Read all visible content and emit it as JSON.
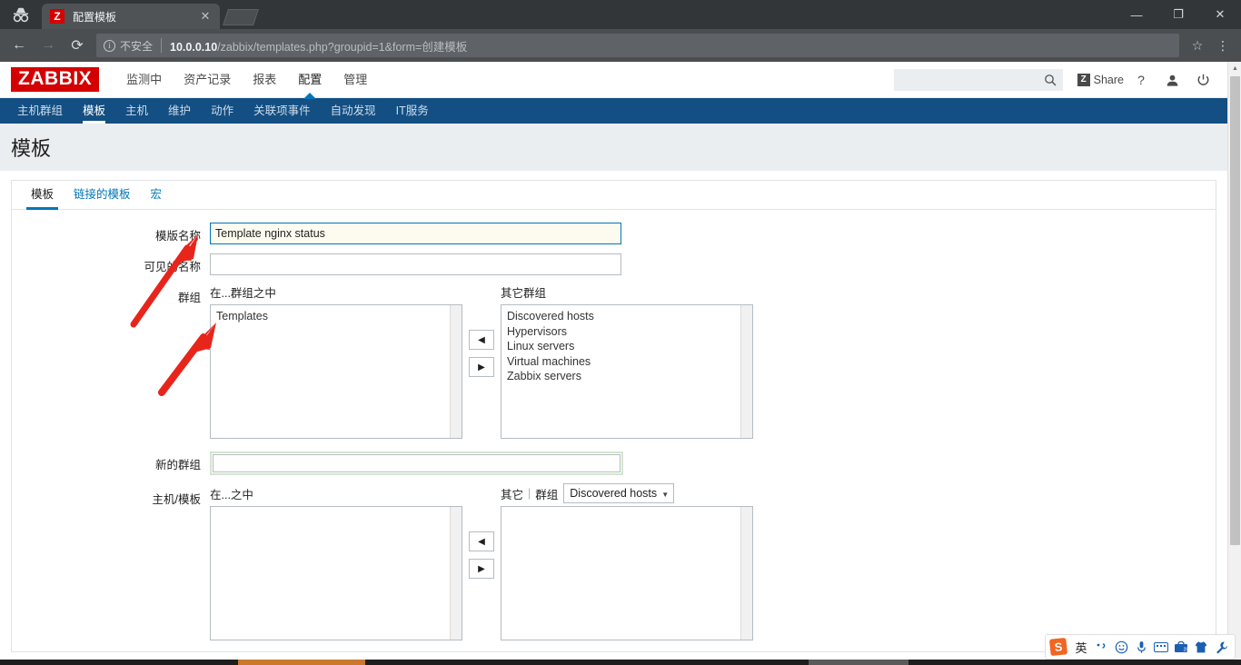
{
  "browser": {
    "tab": {
      "title": "配置模板",
      "favicon_letter": "Z",
      "close_label": "✕"
    },
    "incognito_icon": "incognito-icon",
    "new_tab_label": "",
    "window_controls": {
      "minimize": "—",
      "maximize": "❐",
      "close": "✕"
    },
    "nav": {
      "back": "←",
      "forward": "→",
      "reload": "⟳"
    },
    "omnibox": {
      "security_label": "不安全",
      "info_glyph": "i",
      "url_host": "10.0.0.10",
      "url_path": "/zabbix/templates.php?groupid=1&form=创建模板"
    },
    "toolbar_icons": {
      "bookmark": "☆",
      "menu": "⋮"
    }
  },
  "zabbix": {
    "logo": "ZABBIX",
    "main_nav": [
      {
        "label": "监测中",
        "active": false
      },
      {
        "label": "资产记录",
        "active": false
      },
      {
        "label": "报表",
        "active": false
      },
      {
        "label": "配置",
        "active": true
      },
      {
        "label": "管理",
        "active": false
      }
    ],
    "sub_nav": [
      {
        "label": "主机群组",
        "active": false
      },
      {
        "label": "模板",
        "active": true
      },
      {
        "label": "主机",
        "active": false
      },
      {
        "label": "维护",
        "active": false
      },
      {
        "label": "动作",
        "active": false
      },
      {
        "label": "关联项事件",
        "active": false
      },
      {
        "label": "自动发现",
        "active": false
      },
      {
        "label": "IT服务",
        "active": false
      }
    ],
    "header_right": {
      "search_value": "",
      "search_placeholder": "",
      "search_icon": "search-icon",
      "share_label": "Share",
      "share_badge": "Z",
      "help_label": "?",
      "user_icon": "user-icon",
      "power_icon": "power-icon"
    },
    "page_title": "模板",
    "form_tabs": [
      {
        "label": "模板",
        "active": true
      },
      {
        "label": "链接的模板",
        "active": false
      },
      {
        "label": "宏",
        "active": false
      }
    ],
    "form": {
      "template_name": {
        "label": "模版名称",
        "value": "Template nginx status"
      },
      "visible_name": {
        "label": "可见的名称",
        "value": ""
      },
      "groups": {
        "label": "群组",
        "in_header": "在...群组之中",
        "other_header": "其它群组",
        "in_items": [
          "Templates"
        ],
        "other_items": [
          "Discovered hosts",
          "Hypervisors",
          "Linux servers",
          "Virtual machines",
          "Zabbix servers"
        ],
        "move_left": "◀",
        "move_right": "▶"
      },
      "new_group": {
        "label": "新的群组",
        "value": ""
      },
      "host_templates": {
        "label": "主机/模板",
        "in_header": "在...之中",
        "other_label": "其它",
        "group_label": "群组",
        "group_selected": "Discovered hosts",
        "group_caret": "▼",
        "in_items": [],
        "other_items": [],
        "move_left": "◀",
        "move_right": "▶"
      }
    }
  },
  "ime": {
    "logo": "S",
    "mode_label": "英",
    "items": [
      {
        "name": "punctuation-icon",
        "glyph": "·,"
      },
      {
        "name": "emoji-icon",
        "glyph": "☺"
      },
      {
        "name": "microphone-icon",
        "glyph": "🎤"
      },
      {
        "name": "keyboard-icon",
        "glyph": ""
      },
      {
        "name": "toolbox-icon",
        "glyph": ""
      },
      {
        "name": "skin-icon",
        "glyph": ""
      },
      {
        "name": "wrench-icon",
        "glyph": "🔧"
      }
    ]
  },
  "colors": {
    "brand_red": "#d40000",
    "nav_blue": "#134f82",
    "accent_blue": "#0275b8",
    "chrome_dark": "#323639",
    "annotation_red": "#e8251b"
  }
}
